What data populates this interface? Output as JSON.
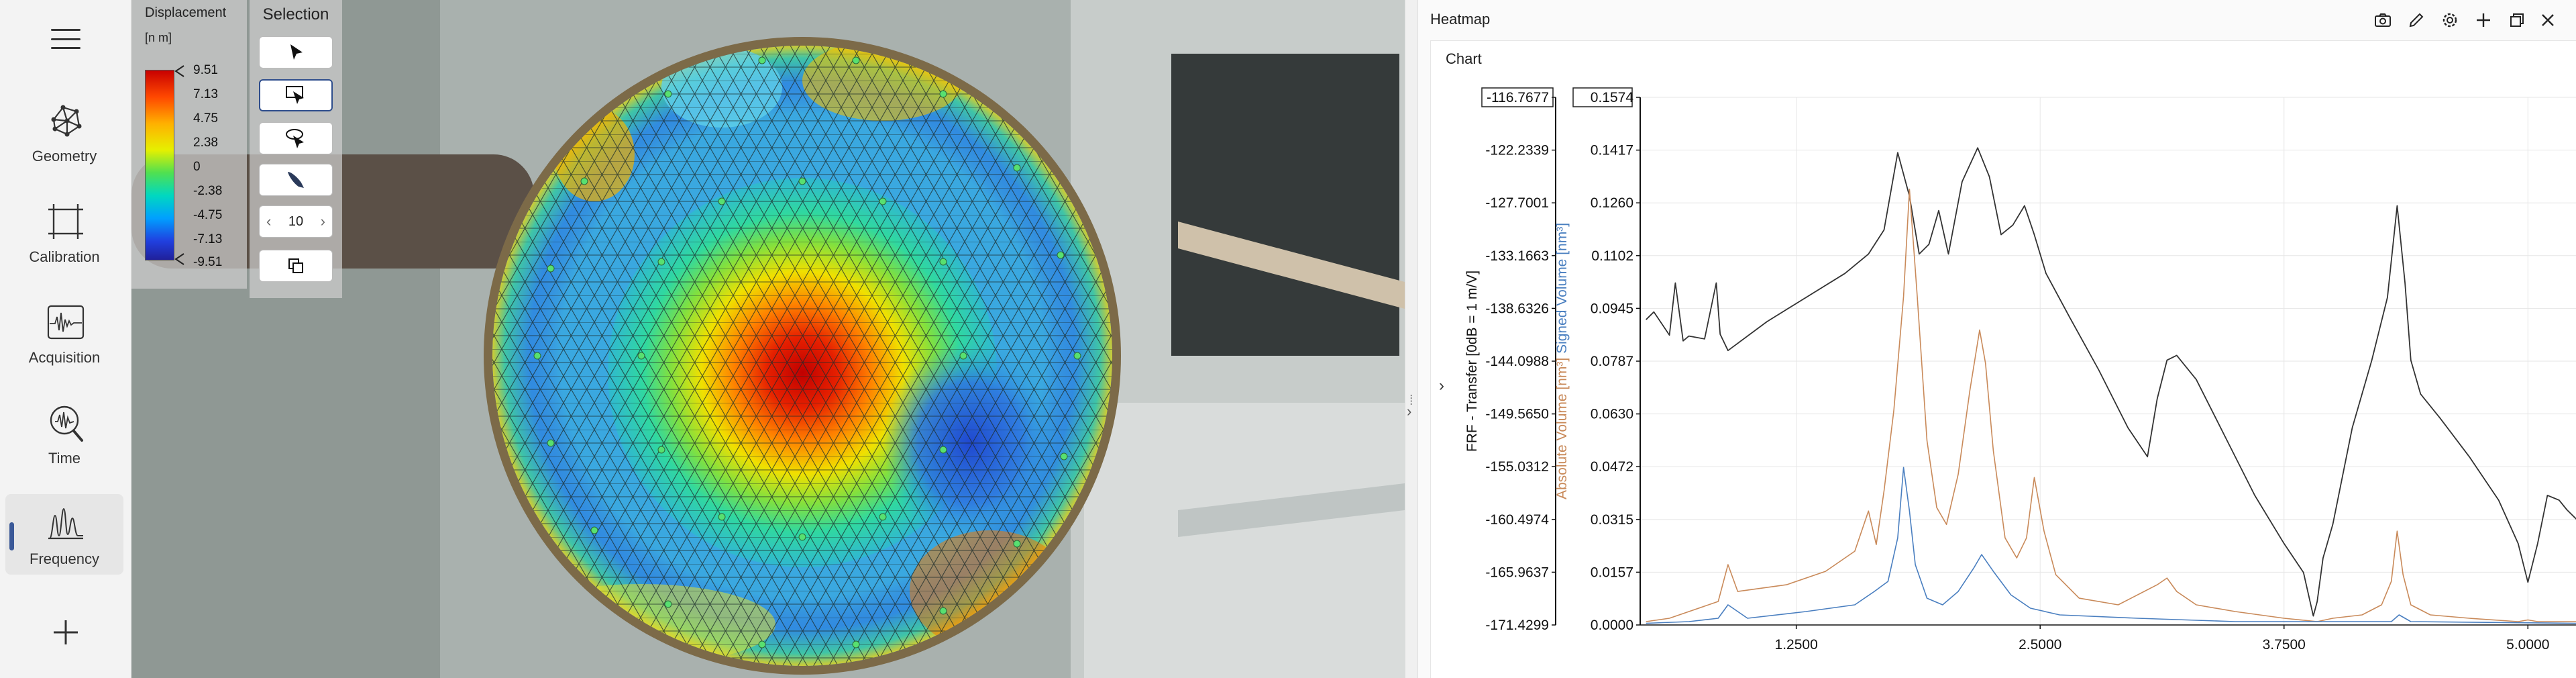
{
  "nav": {
    "menu_icon": "hamburger-icon",
    "items": [
      {
        "label": "Geometry",
        "icon": "geometry-icon"
      },
      {
        "label": "Calibration",
        "icon": "calibration-icon"
      },
      {
        "label": "Acquisition",
        "icon": "acquisition-icon"
      },
      {
        "label": "Time",
        "icon": "time-icon"
      },
      {
        "label": "Frequency",
        "icon": "frequency-icon",
        "active": true
      }
    ],
    "add_icon": "plus-icon"
  },
  "viewport": {
    "legend": {
      "title": "Displacement",
      "unit": "[n m]",
      "ticks": [
        "9.51",
        "7.13",
        "4.75",
        "2.38",
        "0",
        "-2.38",
        "-4.75",
        "-7.13",
        "-9.51"
      ]
    },
    "selection": {
      "title": "Selection",
      "tools": [
        "pointer-icon",
        "box-select-icon",
        "lasso-select-icon",
        "brush-select-icon",
        "copy-selection-icon"
      ],
      "active_tool": 1,
      "brush_size": "10",
      "dec": "‹",
      "inc": "›"
    }
  },
  "panel": {
    "title": "Heatmap",
    "buttons": [
      "camera-icon",
      "edit-icon",
      "settings-icon",
      "add-icon",
      "restore-window-icon",
      "close-icon"
    ],
    "chart_title": "Chart"
  },
  "chart_data": {
    "type": "line",
    "xlim": [
      0.45,
      5.25
    ],
    "x_ticks": [
      "1.2500",
      "2.5000",
      "3.7500",
      "5.0000"
    ],
    "x_tick_values": [
      1.25,
      2.5,
      3.75,
      5.0
    ],
    "left_axis": {
      "label": "FRF - Transfer [0dB = 1 m/V]",
      "range": [
        -171.4299,
        -116.7677
      ],
      "ticks": [
        "-116.7677",
        "-122.2339",
        "-127.7001",
        "-133.1663",
        "-138.6326",
        "-144.0988",
        "-149.5650",
        "-155.0312",
        "-160.4974",
        "-165.9637",
        "-171.4299"
      ]
    },
    "right_axis": {
      "label_parts": [
        {
          "text": "Absolute",
          "color": "#c98a5a"
        },
        {
          "text": "Volume [nm³]",
          "color": "#c98a5a"
        },
        {
          "text": "Signed",
          "color": "#4a7fc0"
        },
        {
          "text": "Volume [nm³]",
          "color": "#4a7fc0"
        }
      ],
      "range": [
        0.0,
        0.1574
      ],
      "ticks": [
        "0.1574",
        "0.1417",
        "0.1260",
        "0.1102",
        "0.0945",
        "0.0787",
        "0.0630",
        "0.0472",
        "0.0315",
        "0.0157",
        "0.0000"
      ]
    },
    "series": [
      {
        "color": "#333333",
        "axis": "left",
        "x": [
          0.48,
          0.52,
          0.6,
          0.63,
          0.67,
          0.7,
          0.78,
          0.84,
          0.86,
          0.9,
          1.1,
          1.3,
          1.5,
          1.62,
          1.7,
          1.77,
          1.83,
          1.88,
          1.93,
          1.98,
          2.03,
          2.1,
          2.18,
          2.24,
          2.3,
          2.36,
          2.42,
          2.47,
          2.53,
          2.65,
          2.8,
          2.95,
          3.05,
          3.1,
          3.15,
          3.2,
          3.3,
          3.45,
          3.6,
          3.75,
          3.85,
          3.9,
          3.92,
          3.95,
          4.0,
          4.1,
          4.2,
          4.28,
          4.33,
          4.37,
          4.4,
          4.45,
          4.55,
          4.7,
          4.85,
          4.95,
          5.0,
          5.05,
          5.1,
          5.16,
          5.2,
          5.25
        ],
        "y": [
          -139.8,
          -139.0,
          -141.4,
          -136.0,
          -142.0,
          -141.5,
          -141.8,
          -136.0,
          -141.3,
          -143.0,
          -140.0,
          -137.5,
          -135.0,
          -133.0,
          -130.5,
          -122.5,
          -127.0,
          -133.0,
          -132.0,
          -128.5,
          -133.0,
          -125.5,
          -122.0,
          -125.0,
          -131.0,
          -130.0,
          -128.0,
          -131.0,
          -135.0,
          -139.5,
          -145.0,
          -151.0,
          -154.0,
          -148.0,
          -144.0,
          -143.5,
          -146.0,
          -152.0,
          -158.0,
          -163.0,
          -166.0,
          -170.5,
          -169.0,
          -164.5,
          -161.0,
          -151.0,
          -144.0,
          -137.5,
          -128.0,
          -136.0,
          -144.0,
          -147.5,
          -150.0,
          -154.0,
          -158.5,
          -163.0,
          -167.0,
          -163.0,
          -158.0,
          -158.5,
          -159.5,
          -160.5
        ]
      },
      {
        "color": "#c98a5a",
        "axis": "right",
        "x": [
          0.48,
          0.6,
          0.7,
          0.85,
          0.9,
          0.95,
          1.2,
          1.4,
          1.55,
          1.62,
          1.66,
          1.7,
          1.75,
          1.8,
          1.83,
          1.87,
          1.92,
          1.97,
          2.02,
          2.08,
          2.14,
          2.19,
          2.22,
          2.26,
          2.32,
          2.38,
          2.43,
          2.47,
          2.52,
          2.58,
          2.7,
          2.9,
          3.1,
          3.15,
          3.2,
          3.3,
          3.5,
          3.75,
          3.92,
          4.0,
          4.15,
          4.25,
          4.3,
          4.33,
          4.36,
          4.4,
          4.5,
          4.7,
          4.95,
          5.0,
          5.05,
          5.1,
          5.25
        ],
        "y": [
          0.001,
          0.002,
          0.004,
          0.007,
          0.018,
          0.01,
          0.012,
          0.016,
          0.022,
          0.034,
          0.024,
          0.04,
          0.064,
          0.098,
          0.13,
          0.098,
          0.055,
          0.035,
          0.03,
          0.045,
          0.07,
          0.088,
          0.078,
          0.052,
          0.026,
          0.02,
          0.026,
          0.044,
          0.028,
          0.015,
          0.008,
          0.006,
          0.012,
          0.014,
          0.01,
          0.006,
          0.004,
          0.002,
          0.001,
          0.002,
          0.003,
          0.006,
          0.013,
          0.028,
          0.015,
          0.006,
          0.003,
          0.002,
          0.001,
          0.0015,
          0.001,
          0.001,
          0.001
        ]
      },
      {
        "color": "#4a7fc0",
        "axis": "right",
        "x": [
          0.48,
          0.7,
          0.85,
          0.9,
          1.0,
          1.3,
          1.55,
          1.65,
          1.72,
          1.77,
          1.8,
          1.83,
          1.86,
          1.92,
          2.0,
          2.08,
          2.16,
          2.2,
          2.26,
          2.35,
          2.45,
          2.6,
          3.0,
          3.5,
          4.3,
          4.34,
          4.4,
          5.25
        ],
        "y": [
          0.0005,
          0.001,
          0.002,
          0.006,
          0.002,
          0.004,
          0.006,
          0.01,
          0.013,
          0.026,
          0.047,
          0.034,
          0.018,
          0.008,
          0.006,
          0.01,
          0.017,
          0.021,
          0.016,
          0.009,
          0.005,
          0.003,
          0.002,
          0.001,
          0.001,
          0.003,
          0.001,
          0.0005
        ]
      }
    ]
  }
}
